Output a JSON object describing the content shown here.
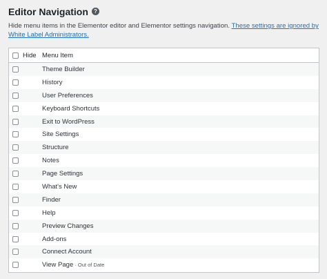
{
  "header": {
    "title": "Editor Navigation",
    "description": "Hide menu items in the Elementor editor and Elementor settings navigation. ",
    "link_text": "These settings are ignored by White Label Administrators."
  },
  "table": {
    "columns": {
      "hide": "Hide",
      "menu_item": "Menu Item"
    },
    "rows": [
      {
        "label": "Theme Builder"
      },
      {
        "label": "History"
      },
      {
        "label": "User Preferences"
      },
      {
        "label": "Keyboard Shortcuts"
      },
      {
        "label": "Exit to WordPress"
      },
      {
        "label": "Site Settings"
      },
      {
        "label": "Structure"
      },
      {
        "label": "Notes"
      },
      {
        "label": "Page Settings"
      },
      {
        "label": "What's New"
      },
      {
        "label": "Finder"
      },
      {
        "label": "Help"
      },
      {
        "label": "Preview Changes"
      },
      {
        "label": "Add-ons"
      },
      {
        "label": "Connect Account"
      },
      {
        "label": "View Page",
        "badge": " · Out of Date"
      }
    ]
  }
}
